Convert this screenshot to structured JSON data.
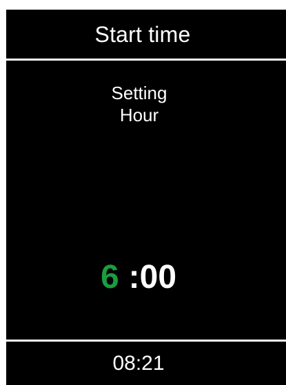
{
  "header": {
    "title": "Start time"
  },
  "setting": {
    "line1": "Setting",
    "line2": "Hour"
  },
  "time_display": {
    "hour": "6",
    "minutes": ":00"
  },
  "clock": {
    "time": "08:21"
  },
  "colors": {
    "background": "#000000",
    "text": "#ffffff",
    "active_field": "#1a9d3e"
  }
}
